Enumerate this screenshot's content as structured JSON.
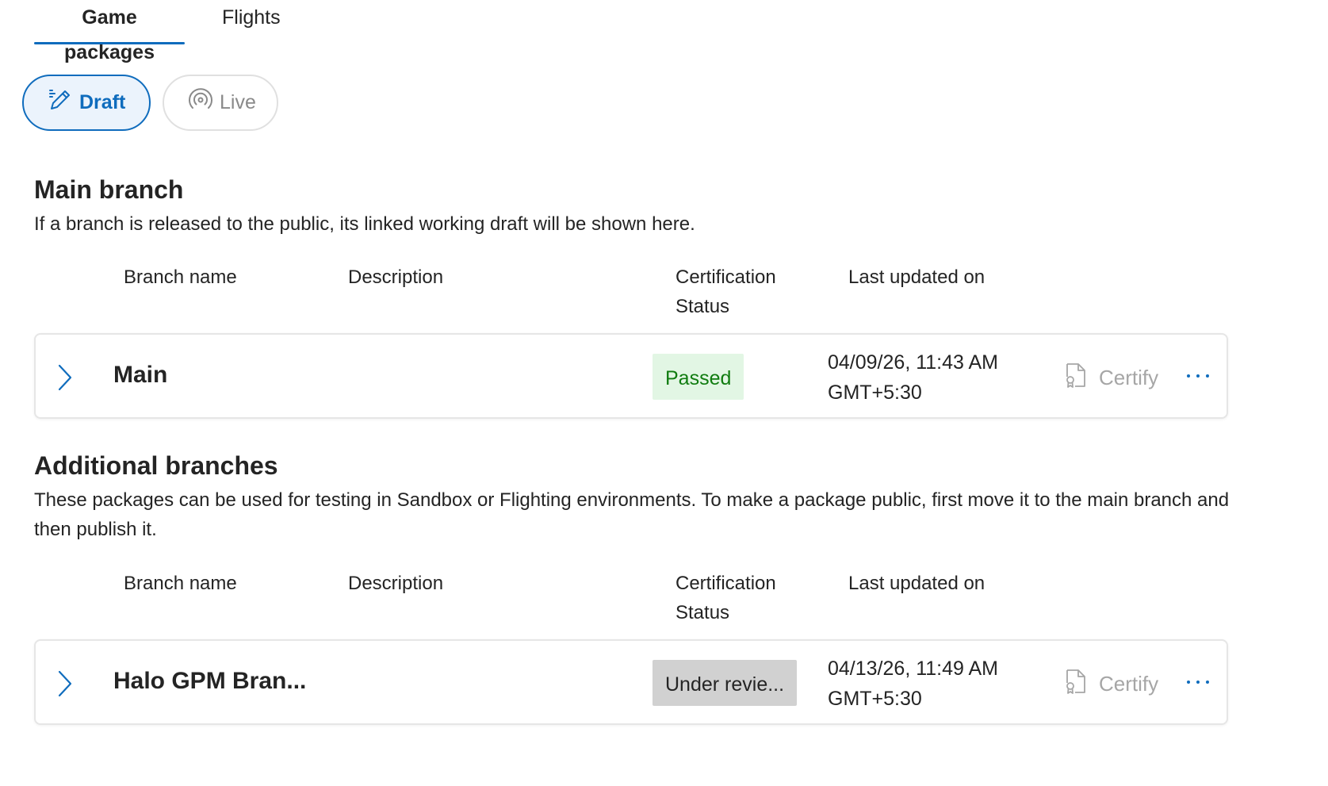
{
  "tabs": [
    {
      "label": "Game packages",
      "active": true
    },
    {
      "label": "Flights",
      "active": false
    }
  ],
  "pills": {
    "draft": {
      "label": "Draft",
      "icon": "pencil-icon",
      "active": true
    },
    "live": {
      "label": "Live",
      "icon": "broadcast-icon",
      "active": false
    }
  },
  "main_branch": {
    "title": "Main branch",
    "subtitle": "If a branch is released to the public, its linked working draft will be shown here.",
    "columns": {
      "branch_name": "Branch name",
      "description": "Description",
      "cert_line1": "Certification",
      "cert_line2": "Status",
      "last_updated": "Last updated on"
    },
    "rows": [
      {
        "name": "Main",
        "description": "",
        "status": "Passed",
        "date_line1": "04/09/26, 11:43 AM",
        "date_line2": "GMT+5:30",
        "certify_label": "Certify"
      }
    ]
  },
  "additional_branches": {
    "title": "Additional branches",
    "subtitle": "These packages can be used for testing in Sandbox or Flighting environments. To make a package public, first move it to the main branch and then publish it.",
    "columns": {
      "branch_name": "Branch name",
      "description": "Description",
      "cert_line1": "Certification",
      "cert_line2": "Status",
      "last_updated": "Last updated on"
    },
    "rows": [
      {
        "name": "Halo GPM Bran...",
        "description": "",
        "status": "Under revie...",
        "date_line1": "04/13/26, 11:49 AM",
        "date_line2": "GMT+5:30",
        "certify_label": "Certify"
      }
    ]
  },
  "colors": {
    "accent": "#0f6cbd",
    "passed_bg": "#e2f6e4",
    "passed_text": "#107c10",
    "review_bg": "#d1d1d1",
    "disabled_text": "#a6a6a6"
  }
}
